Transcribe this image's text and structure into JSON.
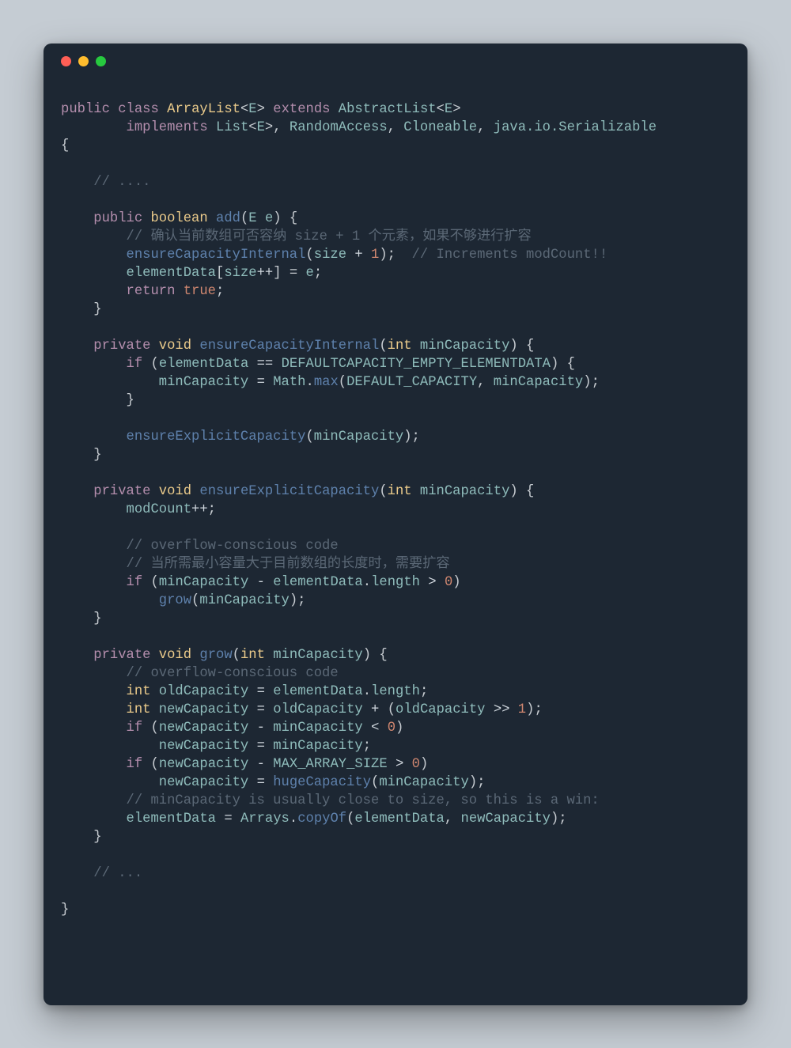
{
  "colors": {
    "bg": "#1d2733",
    "page": "#c5ccd3",
    "kw": "#b48ead",
    "type": "#ebcb8b",
    "name": "#8fbcbb",
    "fn": "#5e81ac",
    "num": "#d08770",
    "cmt": "#5b6876",
    "punc": "#c7ccd1"
  },
  "traffic": {
    "red": "#ff5f56",
    "yellow": "#ffbd2e",
    "green": "#27c93f"
  },
  "tokens": {
    "public": "public",
    "class": "class",
    "extends": "extends",
    "implements": "implements",
    "private": "private",
    "return": "return",
    "if": "if",
    "void": "void",
    "boolean": "boolean",
    "int": "int",
    "true": "true",
    "ArrayList": "ArrayList",
    "AbstractList": "AbstractList",
    "List": "List",
    "RandomAccess": "RandomAccess",
    "Cloneable": "Cloneable",
    "Serializable": "java.io.Serializable",
    "E": "E",
    "e": "e",
    "add": "add",
    "size": "size",
    "elementData": "elementData",
    "ensureCapacityInternal": "ensureCapacityInternal",
    "ensureExplicitCapacity": "ensureExplicitCapacity",
    "grow": "grow",
    "minCapacity": "minCapacity",
    "DEFAULTCAPACITY_EMPTY_ELEMENTDATA": "DEFAULTCAPACITY_EMPTY_ELEMENTDATA",
    "DEFAULT_CAPACITY": "DEFAULT_CAPACITY",
    "Math": "Math",
    "max": "max",
    "modCount": "modCount",
    "length": "length",
    "oldCapacity": "oldCapacity",
    "newCapacity": "newCapacity",
    "MAX_ARRAY_SIZE": "MAX_ARRAY_SIZE",
    "hugeCapacity": "hugeCapacity",
    "Arrays": "Arrays",
    "copyOf": "copyOf",
    "n0": "0",
    "n1": "1"
  },
  "comments": {
    "c_dots1": "// ....",
    "c_addZh": "// 确认当前数组可否容纳 size + 1 个元素，如果不够进行扩容",
    "c_incMod": "// Increments modCount!!",
    "c_overflow1": "// overflow-conscious code",
    "c_growZh": "// 当所需最小容量大于目前数组的长度时，需要扩容",
    "c_overflow2": "// overflow-conscious code",
    "c_win": "// minCapacity is usually close to size, so this is a win:",
    "c_dots2": "// ..."
  }
}
